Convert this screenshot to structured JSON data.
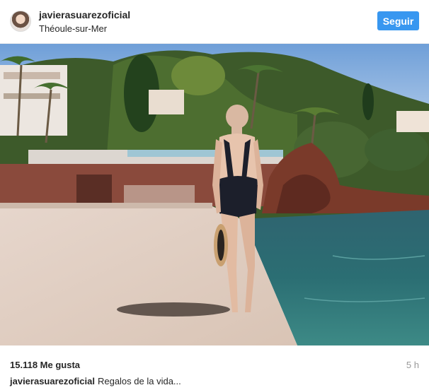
{
  "header": {
    "username": "javierasuarezoficial",
    "location": "Théoule-sur-Mer",
    "follow_label": "Seguir"
  },
  "post": {
    "image_description_icon": "photo",
    "likes": "15.118 Me gusta",
    "time": "5 h",
    "caption_user": "javierasuarezoficial",
    "caption_text": "Regalos de la vida..."
  },
  "colors": {
    "accent": "#3897f0",
    "text": "#262626",
    "muted": "#999999"
  }
}
